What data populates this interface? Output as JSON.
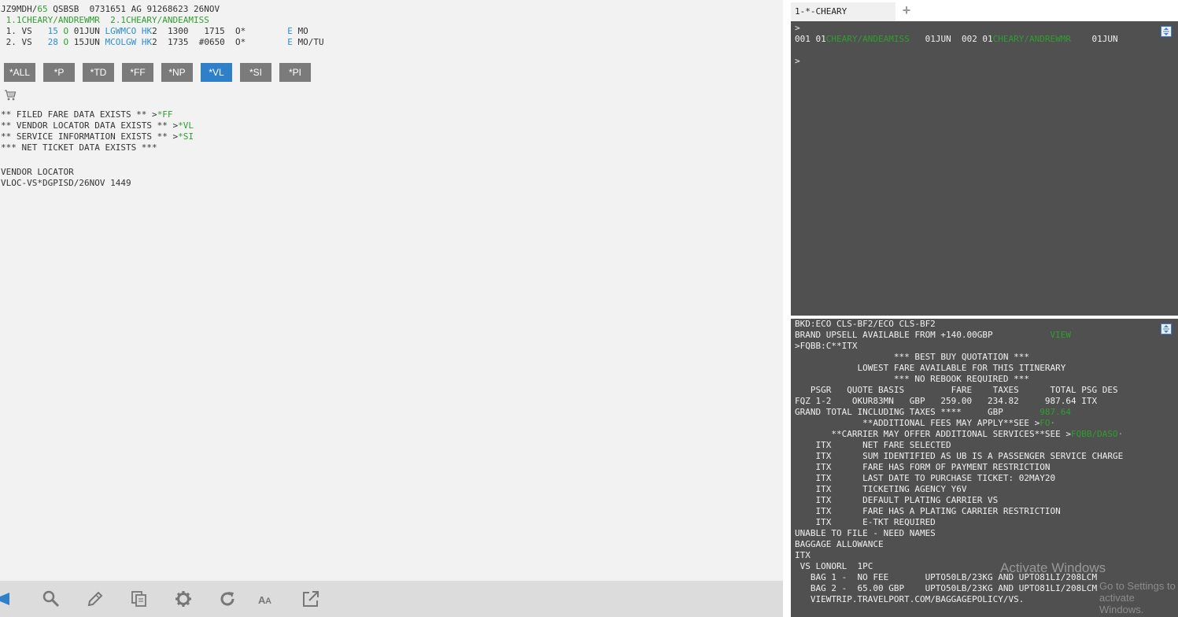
{
  "left": {
    "header_line1": {
      "pre": "JZ9MDH/",
      "num": "65",
      "rest": " QSBSB  0731651 AG 91268623 26NOV"
    },
    "names_line": " 1.1CHEARY/ANDREWMR  2.1CHEARY/ANDEAMISS",
    "seg1": {
      "pre": " 1. VS   ",
      "flight": "15",
      "cls": "O",
      "date": " 01JUN ",
      "route": "LGWMCO",
      "status": "HK",
      "rest1": "2  1300   1715  O*        ",
      "e": "E",
      "day": " MO"
    },
    "seg2": {
      "pre": " 2. VS   ",
      "flight": "28",
      "cls": "O",
      "date": " 15JUN ",
      "route": "MCOLGW",
      "status": "HK",
      "rest1": "2  1735  #0650  O*        ",
      "e": "E",
      "day": " MO/TU"
    },
    "buttons": [
      "*ALL",
      "*P",
      "*TD",
      "*FF",
      "*NP",
      "*VL",
      "*SI",
      "*PI"
    ],
    "notes": [
      {
        "text": "** FILED FARE DATA EXISTS ** >",
        "link": "*FF"
      },
      {
        "text": "** VENDOR LOCATOR DATA EXISTS ** >",
        "link": "*VL"
      },
      {
        "text": "** SERVICE INFORMATION EXISTS ** >",
        "link": "*SI"
      },
      {
        "text": "*** NET TICKET DATA EXISTS ***",
        "link": ""
      }
    ],
    "vendor_title": "VENDOR LOCATOR",
    "vendor_value": "VLOC-VS*DGPISD/26NOV 1449"
  },
  "toolbar": {
    "icons": [
      "megaphone-icon",
      "search-icon",
      "pencil-icon",
      "copy-icon",
      "gear-icon",
      "refresh-icon",
      "font-size-icon",
      "external-link-icon"
    ]
  },
  "right": {
    "tab_label": "1-*-CHEARY",
    "tab_add": "+",
    "pane1": {
      "line1": ">",
      "line2_a": "001 01",
      "line2_name1": "CHEARY/ANDEAMISS",
      "line2_b": "   01JUN  002 01",
      "line2_name2": "CHEARY/ANDREWMR",
      "line2_c": "    01JUN",
      "line3": "",
      "line4": ">"
    },
    "pane2": {
      "lines": [
        "BKD:ECO CLS-BF2/ECO CLS-BF2",
        "BRAND UPSELL AVAILABLE FROM +140.00GBP           ",
        ">FQBB:C**ITX",
        "                   *** BEST BUY QUOTATION ***",
        "            LOWEST FARE AVAILABLE FOR THIS ITINERARY",
        "                   *** NO REBOOK REQUIRED ***",
        "   PSGR   QUOTE BASIS         FARE    TAXES      TOTAL PSG DES",
        "FQZ 1-2    OKUR83MN   GBP   259.00   234.82     987.64 ITX",
        "GRAND TOTAL INCLUDING TAXES ****     GBP       ",
        "             **ADDITIONAL FEES MAY APPLY**SEE >",
        "       **CARRIER MAY OFFER ADDITIONAL SERVICES**SEE >",
        "    ITX      NET FARE SELECTED",
        "    ITX      SUM IDENTIFIED AS UB IS A PASSENGER SERVICE CHARGE",
        "    ITX      FARE HAS FORM OF PAYMENT RESTRICTION",
        "    ITX      LAST DATE TO PURCHASE TICKET: 02MAY20",
        "    ITX      TICKETING AGENCY Y6V",
        "    ITX      DEFAULT PLATING CARRIER VS",
        "    ITX      FARE HAS A PLATING CARRIER RESTRICTION",
        "    ITX      E-TKT REQUIRED",
        "UNABLE TO FILE - NEED NAMES",
        "BAGGAGE ALLOWANCE",
        "ITX",
        " VS LONORL  1PC",
        "   BAG 1 -  NO FEE       UPTO50LB/23KG AND UPTO81LI/208LCM",
        "   BAG 2 -  65.00 GBP    UPTO50LB/23KG AND UPTO81LI/208LCM",
        "   VIEWTRIP.TRAVELPORT.COM/BAGGAGEPOLICY/VS."
      ],
      "view_link": "VIEW",
      "grand_total_value": "987.64",
      "fo_link": "FO",
      "fqbb_link": "FQBB/DASO"
    },
    "watermark_title": "Activate Windows",
    "watermark_sub": "Go to Settings to activate Windows."
  }
}
